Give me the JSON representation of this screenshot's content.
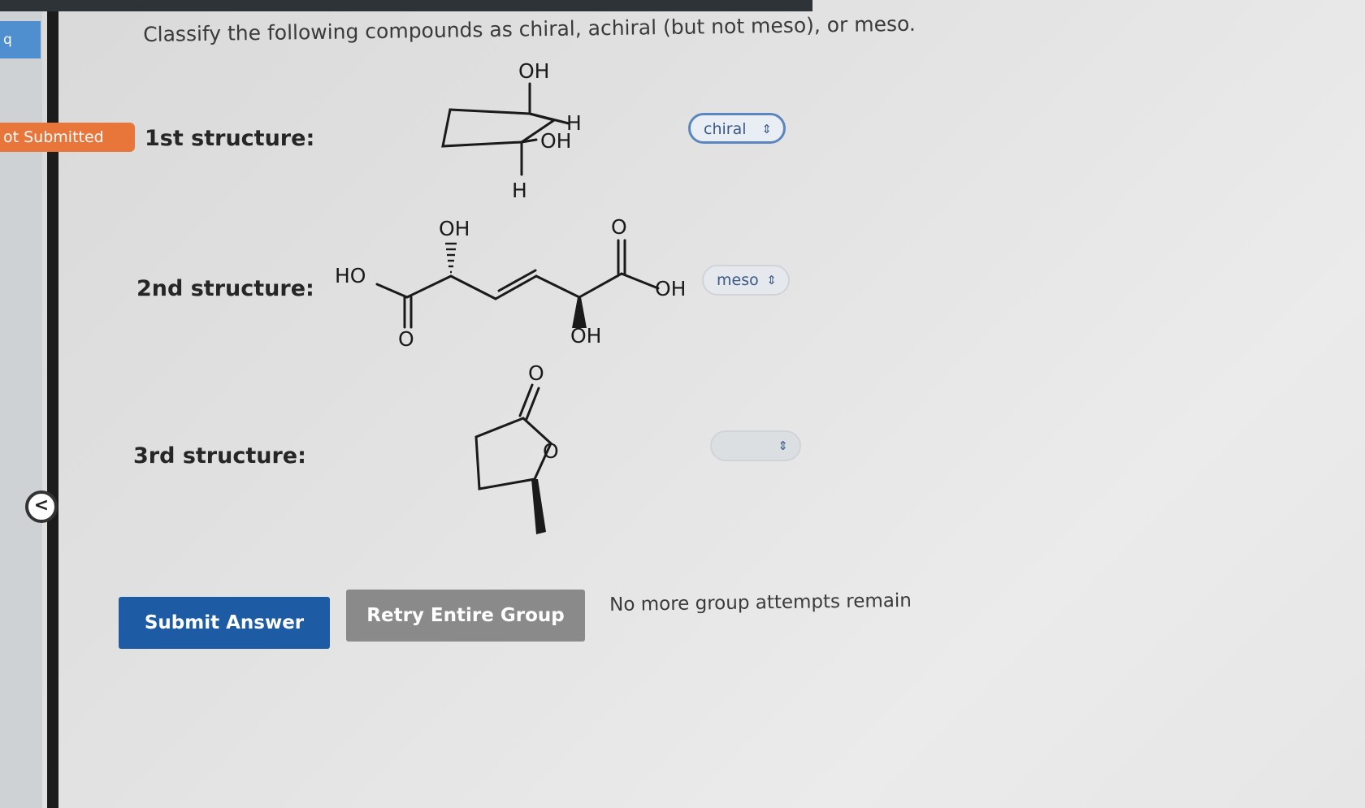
{
  "sidebar": {
    "question_tab": "q",
    "back_icon": "chevron-left-icon"
  },
  "status": {
    "badge": "ot Submitted"
  },
  "question": {
    "prompt": "Classify the following compounds as chiral, achiral (but not meso), or meso."
  },
  "structures": [
    {
      "label": "1st structure:",
      "selected": "chiral",
      "atoms": {
        "oh_top": "OH",
        "h_right": "H",
        "oh_right": "OH",
        "h_bottom": "H"
      }
    },
    {
      "label": "2nd structure:",
      "selected": "meso",
      "atoms": {
        "ho_left": "HO",
        "o_left": "O",
        "oh_top": "OH",
        "o_right": "O",
        "oh_bottom": "OH",
        "oh_right": "OH"
      }
    },
    {
      "label": "3rd structure:",
      "selected": "",
      "atoms": {
        "o_carbonyl": "O",
        "o_ring": "O"
      }
    }
  ],
  "dropdown": {
    "caret_glyph": "⇕",
    "caret_icon": "chevron-updown-icon"
  },
  "actions": {
    "submit_label": "Submit Answer",
    "retry_label": "Retry Entire Group",
    "attempts_note": "No more group attempts remain"
  },
  "colors": {
    "primary": "#1d5ba4",
    "retry": "#8a8a8a",
    "badge": "#e8753a",
    "selected_border": "#5b86bd"
  }
}
